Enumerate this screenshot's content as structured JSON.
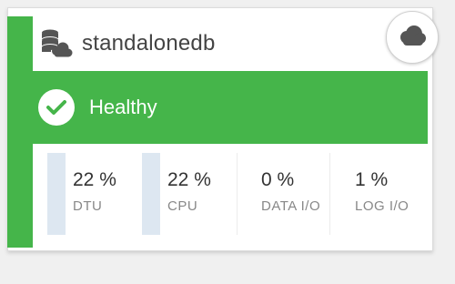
{
  "tile": {
    "title": "standalonedb",
    "icon": "database-cloud-icon",
    "action_icon": "cloud-icon",
    "accent_color": "#45b54a"
  },
  "status": {
    "label": "Healthy",
    "icon": "check-circle-icon",
    "color": "#45b54a"
  },
  "metrics": [
    {
      "value": "22 %",
      "label": "DTU",
      "level_percent": 22
    },
    {
      "value": "22 %",
      "label": "CPU",
      "level_percent": 22
    },
    {
      "value": "0 %",
      "label": "DATA I/O",
      "level_percent": 0
    },
    {
      "value": "1 %",
      "label": "LOG I/O",
      "level_percent": 1
    }
  ]
}
